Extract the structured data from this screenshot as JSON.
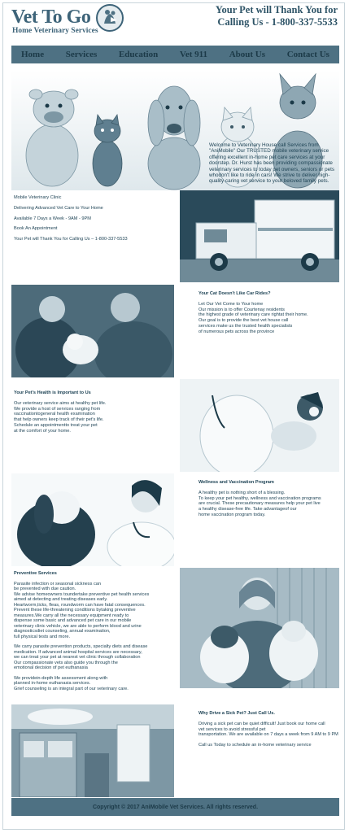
{
  "header": {
    "logo_title": "Vet To Go",
    "logo_subtitle": "Home Veterinary Services",
    "phone_line1": "Your Pet will Thank You for",
    "phone_line2": "Calling Us - 1-800-337-5533"
  },
  "nav": {
    "items": [
      "Home",
      "Services",
      "Education",
      "Vet 911",
      "About Us",
      "Contact Us"
    ]
  },
  "hero": {
    "text": "Welcome to Veterinary House call Services from \"AniMobile\" Our TRUSTED mobile veterinary service offering excellent in-home pet care services at your doorstep. Dr. Hurst has been providing compassionate veterinary services to today pet owners, seniors or pets whodon't like to ride in cars! We strive to deliver high-quality caring vet service to your beloved family pets."
  },
  "section1": {
    "lines": [
      "Mobile Veterinary Clinic",
      "Delivering Advanced Vet Care to Your Home",
      "Available 7 Days a Week - 9AM - 9PM",
      "Book An Appointment",
      "Your Pet will Thank You for Calling Us – 1-800-337-5533"
    ]
  },
  "section2": {
    "heading": "Your Cat Doesn't Like Car Rides?",
    "lines": [
      "Let Our Vet Come to Your home",
      "Our mission is to offer Courtenay residents",
      "the highest grade of veterinary care rightat their home.",
      "Our goal is to provide the best vet house call",
      "services make us the trusted health specialists",
      "of numerous pets across the province"
    ]
  },
  "section3": {
    "heading": "Your Pet's Health is Important to Us",
    "lines": [
      "Our veterinary service aims at healthy pet life.",
      "We provide a host of services ranging from",
      "vaccinationtogeneral health examination",
      "that help owners keep track of their pet's life.",
      "Schedule an appointmentto treat your pet",
      "at the comfort of your home."
    ]
  },
  "section4": {
    "heading": "Wellness and Vaccination Program",
    "lines": [
      "A healthy pet is nothing short of a blessing.",
      "To keep your pet healthy, wellness and vaccination programs",
      "are crucial. These precautionary measures help your pet live",
      "a healthy disease-free life. Take advantageof our",
      "home vaccination program today."
    ]
  },
  "section5": {
    "heading": "Preventive Services",
    "para1": [
      "Parasite infection or seasonal sickness can",
      "be prevented with due caution.",
      "We advise homeowners toundertake preventive pet health services",
      "aimed at detecting and treating diseases early.",
      "Heartworm,ticks, fleas, roundworm can have fatal consequences.",
      "Prevent these life-threatening conditions bytaking preventive",
      "measures.We carry all the necessary equipment ready to",
      "dispense some basic and advanced pet care in our mobile",
      "veterinary clinic vehicle, we are able to perform blood and urine",
      "diagnosticsdiet counseling, annual examination,",
      "full physical tests and more."
    ],
    "para2": [
      "We carry parasite prevention products, specialty diets and disease",
      "medication. If advanced animal hospital services are necessary,",
      "we can treat your pet at nearest vet clinic through collaboration",
      "Our compassionate vets also guide you through the",
      "emotional decision of pet euthanasia"
    ],
    "para3": [
      "We providein-depth life assessment along with",
      "planned in-home euthanasia services.",
      "Grief counseling is an integral part of our veterinary care."
    ]
  },
  "section6": {
    "heading": "Why Drive a Sick Pet? Just Call Us.",
    "para1": [
      "Driving a sick pet can be quiet difficult! Just book our home call",
      "vet services to avoid stressful pet",
      "transportation. We are available on 7 days a week from 9 AM to 9 PM"
    ],
    "para2": "Call us Today to schedule an in-home veterinary service"
  },
  "footer": {
    "copyright": "Copyright © 2017 AniMobile Vet Services. All rights reserved."
  },
  "colors": {
    "primary": "#4e7183",
    "text": "#1f4456",
    "dark": "#1c3a48"
  },
  "icons": [
    "paw-logo-icon"
  ]
}
